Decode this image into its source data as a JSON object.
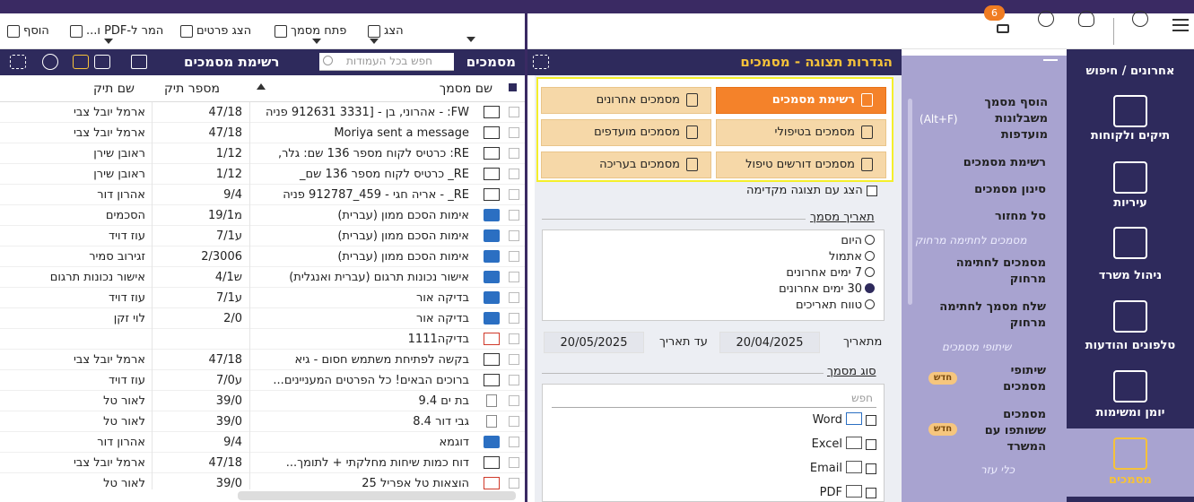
{
  "left_toolbar": {
    "add": "הוסף",
    "convert_pdf": "המר ל-PDF ו...",
    "show_details": "הצג פרטים",
    "open_doc": "פתח מסמך",
    "show": "הצג"
  },
  "left_header": {
    "title": "מסמכים",
    "list_title": "רשימת מסמכים",
    "search_placeholder": "חפש בכל העמודות"
  },
  "grid": {
    "columns": {
      "doc_name": "שם מסמך",
      "case_num": "מספר תיק",
      "case_name": "שם תיק"
    },
    "rows": [
      {
        "type": "mail",
        "name": "FW: - אהרוני, בן - [3331 912631 פניה",
        "num": "47/18",
        "case": "ארמל יובל צבי"
      },
      {
        "type": "mail",
        "name": "Moriya sent a message",
        "num": "47/18",
        "case": "ארמל יובל צבי"
      },
      {
        "type": "mail",
        "name": "RE: כרטיס לקוח מספר 136 שם: גלר,",
        "num": "1/12",
        "case": "ראובן שירן"
      },
      {
        "type": "mail",
        "name": "RE_ כרטיס לקוח מספר 136 שם_",
        "num": "1/12",
        "case": "ראובן שירן"
      },
      {
        "type": "mail",
        "name": "RE_ - אריה חגי - 459_912787 פניה",
        "num": "9/4",
        "case": "אהרון דור"
      },
      {
        "type": "word",
        "name": "אימות הסכם ממון (עברית)",
        "num": "מ19/1",
        "case": "הסכמים"
      },
      {
        "type": "word",
        "name": "אימות הסכם ממון (עברית)",
        "num": "ע7/1",
        "case": "עוז דויד"
      },
      {
        "type": "word",
        "name": "אימות הסכם ממון (עברית)",
        "num": "2/3006",
        "case": "זגירוב סמיר"
      },
      {
        "type": "word",
        "name": "אישור נכונות תרגום (עברית ואנגלית)",
        "num": "ש4/1",
        "case": "אישור נכונות תרגום"
      },
      {
        "type": "word",
        "name": "בדיקה אור",
        "num": "ע7/1",
        "case": "עוז דויד"
      },
      {
        "type": "word",
        "name": "בדיקה אור",
        "num": "2/0",
        "case": "לוי זקן"
      },
      {
        "type": "pdf",
        "name": "בדיקה1111",
        "num": "",
        "case": ""
      },
      {
        "type": "mail",
        "name": "בקשה לפתיחת משתמש חסום - גיא",
        "num": "47/18",
        "case": "ארמל יובל צבי"
      },
      {
        "type": "mail",
        "name": "ברוכים הבאים! כל הפרטים המעניינים...",
        "num": "ע7/0",
        "case": "עוז דויד"
      },
      {
        "type": "txt",
        "name": "בת ים 9.4",
        "num": "39/0",
        "case": "לאור טל"
      },
      {
        "type": "txt",
        "name": "גבי דור 8.4",
        "num": "39/0",
        "case": "לאור טל"
      },
      {
        "type": "word",
        "name": "דוגמא",
        "num": "9/4",
        "case": "אהרון דור"
      },
      {
        "type": "mail",
        "name": "דוח כמות שיחות מחלקתי + לתומך...",
        "num": "47/18",
        "case": "ארמל יובל צבי"
      },
      {
        "type": "pdf",
        "name": "הוצאות טל אפריל 25",
        "num": "39/0",
        "case": "לאור טל"
      }
    ]
  },
  "right_toolbar": {
    "badge": "6"
  },
  "settings": {
    "title": "הגדרות תצוגה - מסמכים",
    "tiles": {
      "doc_list": "רשימת מסמכים",
      "recent_docs": "מסמכים אחרונים",
      "in_treatment": "מסמכים בטיפולי",
      "favorite_docs": "מסמכים מועדפים",
      "need_treatment": "מסמכים דורשים טיפול",
      "editing_docs": "מסמכים בעריכה"
    },
    "preview_label": "הצג עם תצוגה מקדימה",
    "date_section": "תאריך מסמך",
    "date_options": [
      "היום",
      "אתמול",
      "7 ימים אחרונים",
      "30 ימים אחרונים",
      "טווח תאריכים"
    ],
    "from_label": "מתאריך",
    "from_value": "20/04/2025",
    "to_label": "עד תאריך",
    "to_value": "20/05/2025",
    "type_section": "סוג מסמך",
    "type_search": "חפש",
    "types": [
      "Word",
      "Excel",
      "Email",
      "PDF"
    ]
  },
  "nav_menu": {
    "add_from_templates": "הוסף מסמך משבלונות מועדפות",
    "add_shortcut": "(Alt+F)",
    "doc_list": "רשימת מסמכים",
    "filter_docs": "סינון מסמכים",
    "recycle": "סל מחזור",
    "remote_sign_section": "מסמכים לחתימה מרחוק",
    "remote_sign": "מסמכים לחתימה מרחוק",
    "send_remote_sign": "שלח מסמך לחתימה מרחוק",
    "sharing_section": "שיתופי מסמכים",
    "share_docs": "שיתופי מסמכים",
    "shared_office": "מסמכים ששותפו עם המשרד",
    "new_badge": "חדש",
    "tools_section": "כלי עזר"
  },
  "app_nav": {
    "recent_search": "אחרונים / חיפוש",
    "cases_clients": "תיקים ולקוחות",
    "cities": "עיריות",
    "office_mgmt": "ניהול משרד",
    "phones_msgs": "טלפונים והודעות",
    "diary_tasks": "יומן ומשימות",
    "documents": "מסמכים"
  }
}
